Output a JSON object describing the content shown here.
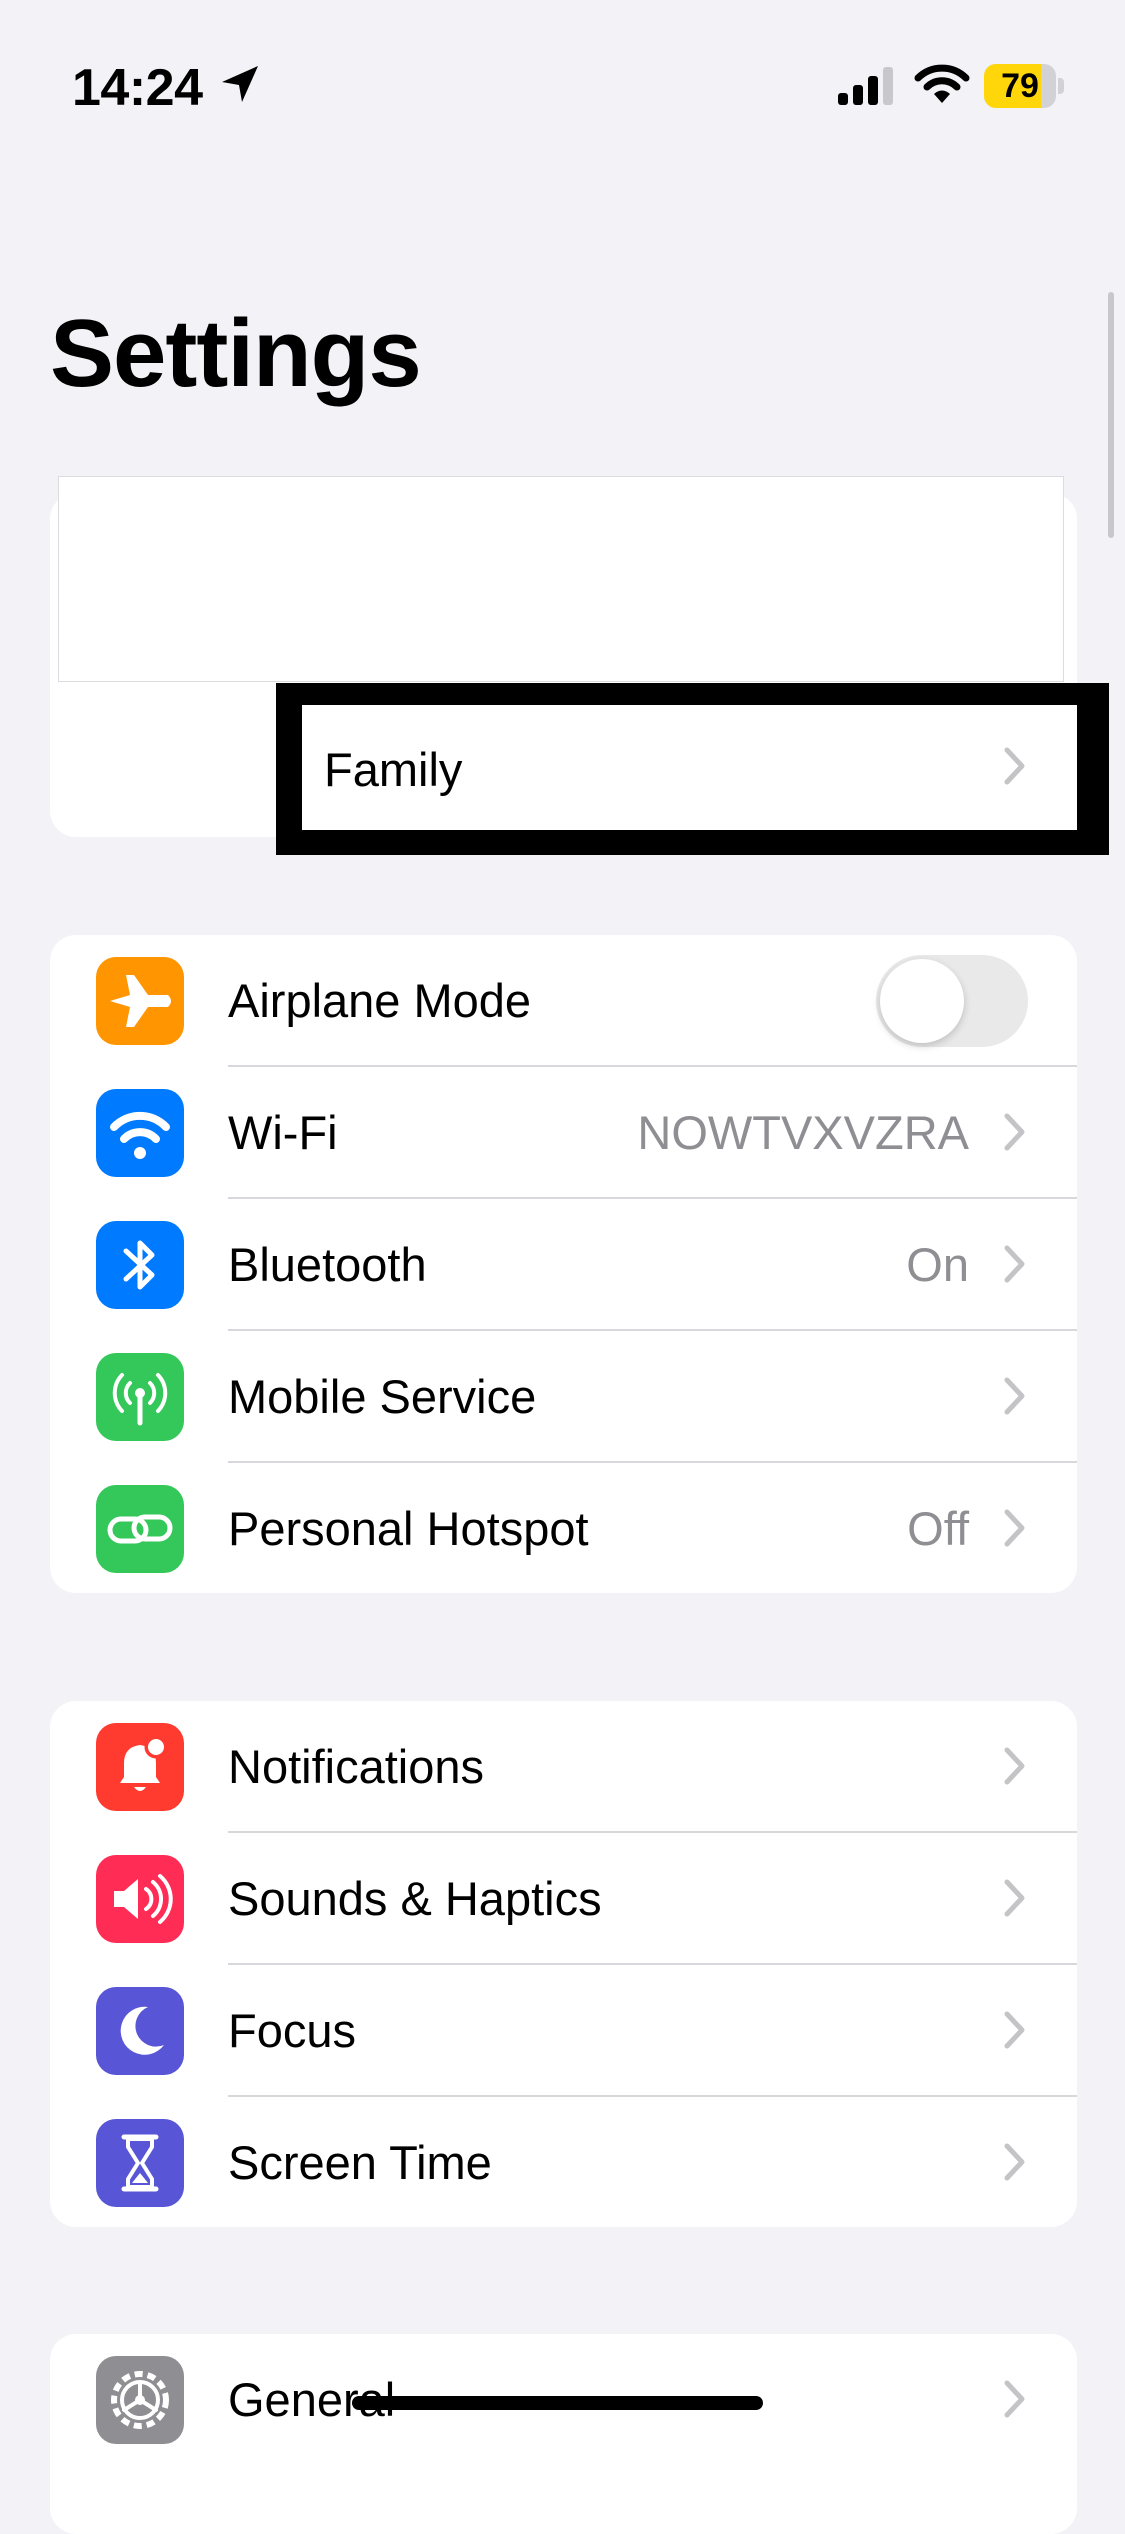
{
  "status_bar": {
    "time": "14:24",
    "battery": "79",
    "battery_level": 0.79
  },
  "page": {
    "title": "Settings"
  },
  "account": {
    "family_label": "Family"
  },
  "groups": {
    "connectivity": {
      "airplane_mode": {
        "label": "Airplane Mode",
        "toggle_on": false,
        "icon": "airplane-icon",
        "color": "#ff9500"
      },
      "wifi": {
        "label": "Wi-Fi",
        "value": "NOWTVXVZRA",
        "icon": "wifi-icon",
        "color": "#007aff"
      },
      "bluetooth": {
        "label": "Bluetooth",
        "value": "On",
        "icon": "bluetooth-icon",
        "color": "#007aff"
      },
      "mobile_service": {
        "label": "Mobile Service",
        "icon": "antenna-icon",
        "color": "#34c759"
      },
      "personal_hotspot": {
        "label": "Personal Hotspot",
        "value": "Off",
        "icon": "link-icon",
        "color": "#34c759"
      }
    },
    "attention": {
      "notifications": {
        "label": "Notifications",
        "icon": "bell-icon",
        "color": "#ff3b30"
      },
      "sounds": {
        "label": "Sounds & Haptics",
        "icon": "speaker-icon",
        "color": "#ff2d55"
      },
      "focus": {
        "label": "Focus",
        "icon": "moon-icon",
        "color": "#5856d6"
      },
      "screen_time": {
        "label": "Screen Time",
        "icon": "hourglass-icon",
        "color": "#5856d6"
      }
    },
    "system": {
      "general": {
        "label": "General",
        "icon": "gear-icon",
        "color": "#8e8e93"
      }
    }
  }
}
